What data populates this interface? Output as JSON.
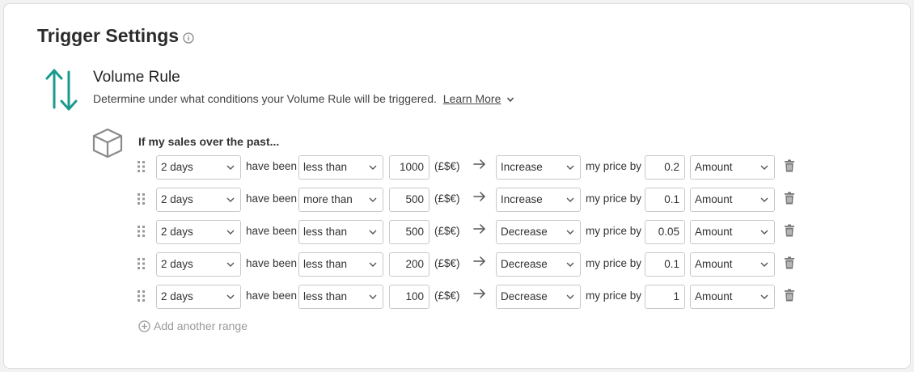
{
  "header": {
    "title": "Trigger Settings"
  },
  "rule": {
    "title": "Volume Rule",
    "description": "Determine under what conditions your Volume Rule will be triggered.",
    "learn_more": "Learn More"
  },
  "condition_label": "If my sales over the past...",
  "labels": {
    "have_been": "have been",
    "currency": "(£$€)",
    "my_price_by": "my price by"
  },
  "rows": [
    {
      "period": "2 days",
      "comparison": "less than",
      "threshold": "1000",
      "direction": "Increase",
      "amount": "0.2",
      "unit": "Amount"
    },
    {
      "period": "2 days",
      "comparison": "more than",
      "threshold": "500",
      "direction": "Increase",
      "amount": "0.1",
      "unit": "Amount"
    },
    {
      "period": "2 days",
      "comparison": "less than",
      "threshold": "500",
      "direction": "Decrease",
      "amount": "0.05",
      "unit": "Amount"
    },
    {
      "period": "2 days",
      "comparison": "less than",
      "threshold": "200",
      "direction": "Decrease",
      "amount": "0.1",
      "unit": "Amount"
    },
    {
      "period": "2 days",
      "comparison": "less than",
      "threshold": "100",
      "direction": "Decrease",
      "amount": "1",
      "unit": "Amount"
    }
  ],
  "add_range": "Add another range",
  "colors": {
    "accent": "#1a9a8e",
    "icon_gray": "#888888",
    "border": "#c8c8c8"
  }
}
